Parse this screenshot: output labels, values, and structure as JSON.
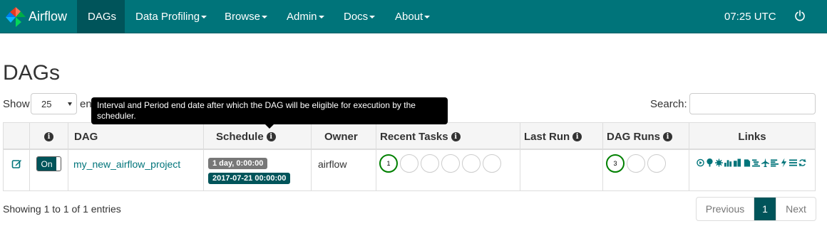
{
  "navbar": {
    "brand": "Airflow",
    "items": [
      {
        "label": "DAGs"
      },
      {
        "label": "Data Profiling"
      },
      {
        "label": "Browse"
      },
      {
        "label": "Admin"
      },
      {
        "label": "Docs"
      },
      {
        "label": "About"
      }
    ],
    "clock": "07:25 UTC"
  },
  "page": {
    "title": "DAGs"
  },
  "controls": {
    "show_label": "Show",
    "page_length": "25",
    "entries_label": "en",
    "search_label": "Search:",
    "search_value": ""
  },
  "tooltip": {
    "text": "Interval and Period end date after which the DAG will be eligible for execution by the scheduler."
  },
  "table": {
    "columns": [
      "DAG",
      "Schedule",
      "Owner",
      "Recent Tasks",
      "Last Run",
      "DAG Runs",
      "Links"
    ],
    "rows": [
      {
        "toggle": "On",
        "dag": "my_new_airflow_project",
        "schedule_interval": "1 day, 0:00:00",
        "schedule_date": "2017-07-21 00:00:00",
        "owner": "airflow",
        "recent_tasks_success": "1",
        "dag_runs_success": "3"
      }
    ]
  },
  "footer": {
    "info": "Showing 1 to 1 of 1 entries",
    "prev": "Previous",
    "page": "1",
    "next": "Next"
  },
  "colors": {
    "navbar": "#00747a",
    "active": "#00545a",
    "success": "#008000"
  }
}
